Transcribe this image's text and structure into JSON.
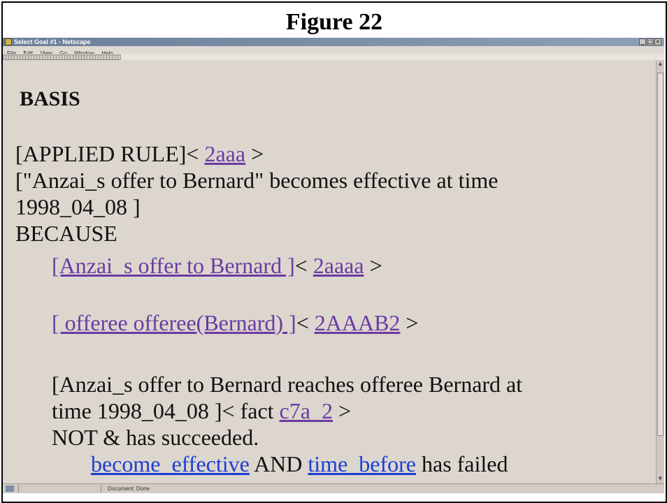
{
  "figure_title": "Figure 22",
  "window": {
    "title": "Select Goal #1 - Netscape",
    "buttons": [
      "_",
      "□",
      "×"
    ]
  },
  "menu": [
    "File",
    "Edit",
    "View",
    "Go",
    "Window",
    "Help"
  ],
  "content": {
    "heading": "BASIS",
    "rule_prefix": "[APPLIED RULE]",
    "lt": "<",
    "gt": ">",
    "rule_link": "2aaa",
    "statement_1": "[\"Anzai_s offer to Bernard\" becomes effective at time",
    "statement_2": "1998_04_08 ]",
    "because": "BECAUSE",
    "item1_link": "[Anzai_s offer to Bernard ]",
    "item1_ref": "2aaaa",
    "item2_link": "[ offeree offeree(Bernard) ]",
    "item2_ref": "2AAAB2",
    "item3_line1": "[Anzai_s offer to Bernard reaches offeree Bernard at",
    "item3_line2": "time 1998_04_08 ]",
    "fact_text": "fact",
    "item3_ref": "c7a_2",
    "not_line": "NOT & has succeeded.",
    "become_effective": "become_effective",
    "and_text": "AND",
    "time_before": "time_before",
    "failed_text": "has failed"
  },
  "status": {
    "text": "Document: Done"
  }
}
